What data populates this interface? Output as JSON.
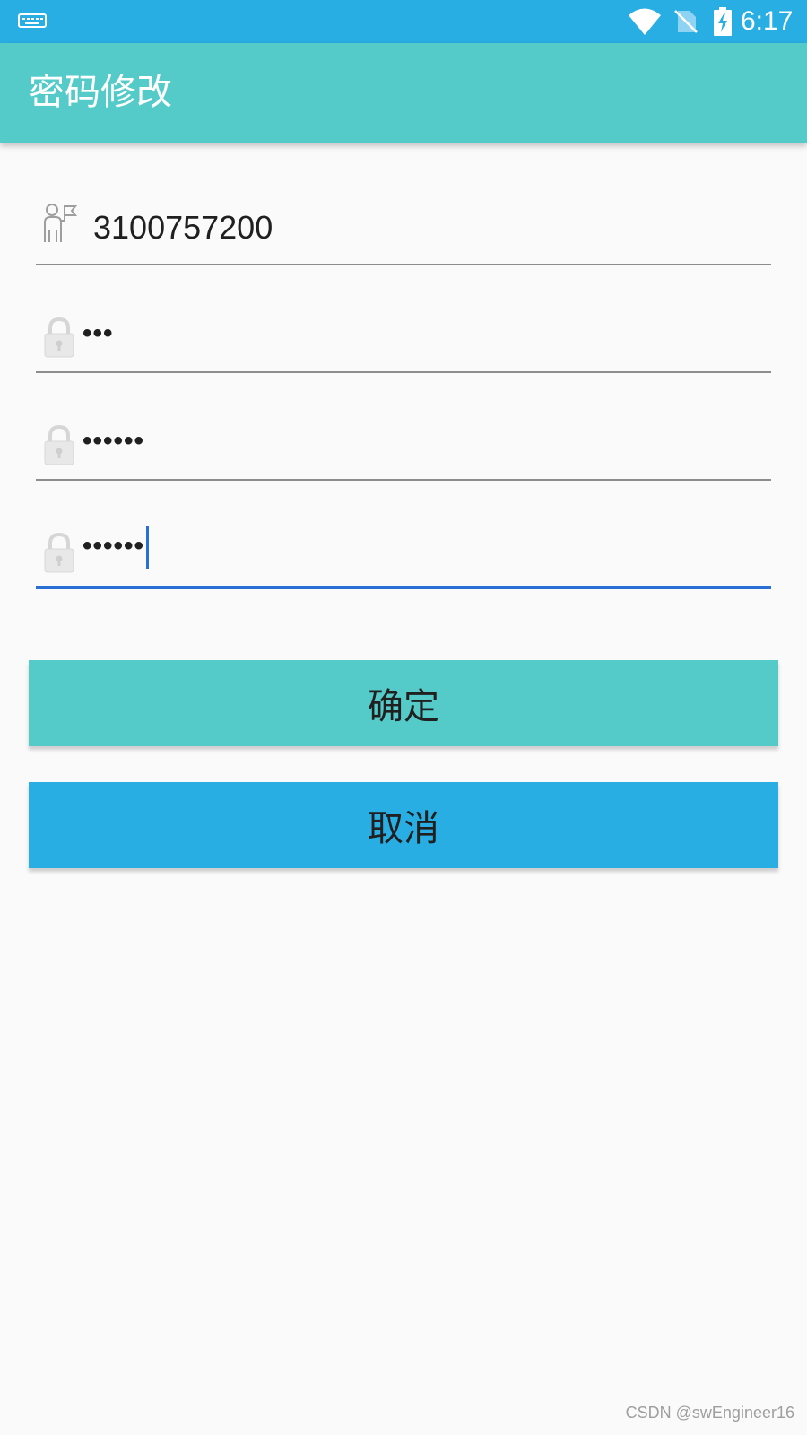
{
  "status_bar": {
    "time": "6:17",
    "icons": [
      "keyboard-icon",
      "wifi-icon",
      "no-sim-icon",
      "battery-charging-icon"
    ],
    "background": "#29aee4"
  },
  "app_bar": {
    "title": "密码修改",
    "background": "#55cbc9"
  },
  "form": {
    "account": {
      "value": "3100757200",
      "icon": "user-flag-icon"
    },
    "old_password": {
      "value": "•••",
      "icon": "lock-icon"
    },
    "new_password": {
      "value": "••••••",
      "icon": "lock-icon"
    },
    "confirm_password": {
      "value": "••••••",
      "icon": "lock-icon",
      "focused": true
    }
  },
  "buttons": {
    "confirm_label": "确定",
    "cancel_label": "取消",
    "confirm_color": "#55cbc9",
    "cancel_color": "#29aee4"
  },
  "colors": {
    "focus_underline": "#2a6fd6",
    "underline": "#8d8d8d",
    "page_background": "#fafafa"
  },
  "watermark": "CSDN @swEngineer16"
}
